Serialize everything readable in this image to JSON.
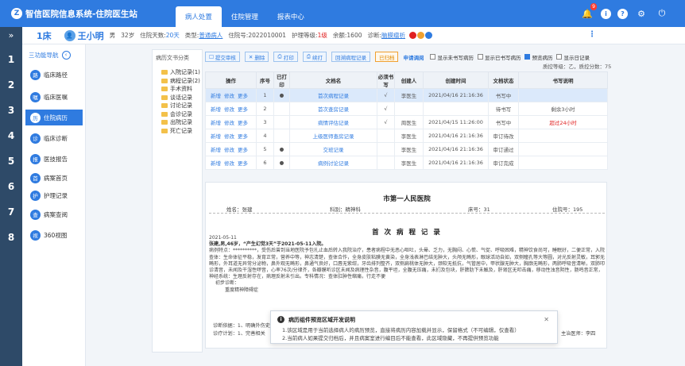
{
  "app": {
    "logo_text": "Z",
    "title": "智信医院信息系统-住院医生站"
  },
  "nav": [
    "病人处置",
    "住院管理",
    "报表中心"
  ],
  "top_icons": {
    "notification_count": "9"
  },
  "patient": {
    "bed": "1床",
    "name": "王小明",
    "gender": "男",
    "age": "32岁",
    "days_label": "住院天数:",
    "days": "20天",
    "type_label": "类型:",
    "type": "普通病人",
    "no_label": "住院号:",
    "no": "2022010001",
    "care_label": "护理等级:",
    "care": "1级",
    "balance_label": "余额:",
    "balance": "1600",
    "diag_label": "诊断:",
    "diag": "脑膜瘤析",
    "tag_colors": [
      "#e02020",
      "#f0a030",
      "#2f7be0"
    ]
  },
  "rail": [
    "1",
    "2",
    "3",
    "4",
    "5",
    "6",
    "7",
    "8"
  ],
  "sidebar": {
    "header": "三功能导航",
    "items": [
      {
        "label": "临床路径",
        "icon": "路"
      },
      {
        "label": "临床医嘱",
        "icon": "嘱"
      },
      {
        "label": "住院病历",
        "icon": "历",
        "active": true
      },
      {
        "label": "临床诊断",
        "icon": "诊"
      },
      {
        "label": "医技报告",
        "icon": "报"
      },
      {
        "label": "病案首页",
        "icon": "首"
      },
      {
        "label": "护理记录",
        "icon": "护"
      },
      {
        "label": "病案查阅",
        "icon": "查"
      },
      {
        "label": "360视图",
        "icon": "视"
      }
    ]
  },
  "categories": {
    "title": "病历文书分类",
    "items": [
      "入院记录(1)",
      "病程记录(2)",
      "手术资料",
      "谈话记录",
      "讨论记录",
      "会诊记录",
      "出院记录",
      "死亡记录"
    ]
  },
  "toolbar": {
    "buttons": [
      "提交审核",
      "删除",
      "打印",
      "续打",
      "回溯病程记录"
    ],
    "orange": "已归档",
    "link": "申请调阅",
    "checks": [
      {
        "label": "显示未书写病历",
        "on": false
      },
      {
        "label": "显示已书写病历",
        "on": false
      },
      {
        "label": "预览病历",
        "on": true
      },
      {
        "label": "显示日记录",
        "on": false
      }
    ],
    "score": "质控等级：乙，质控分数：75"
  },
  "table": {
    "headers": [
      "操作",
      "序号",
      "已打印",
      "文档名",
      "必须书写",
      "创建人",
      "创建时间",
      "文档状态",
      "书写说明"
    ],
    "rows": [
      {
        "ops": [
          "新增",
          "修改",
          "更多"
        ],
        "no": "1",
        "printed": "●",
        "name": "首次病程记录",
        "must": "√",
        "creator": "李医生",
        "time": "2021/04/16 21:16:36",
        "status": "书写中",
        "note": "",
        "sel": true
      },
      {
        "ops": [
          "新增",
          "修改",
          "更多"
        ],
        "no": "2",
        "printed": "",
        "name": "首次查房记录",
        "must": "√",
        "creator": "",
        "time": "",
        "status": "待书写",
        "note": "剩余3小时",
        "sel": false
      },
      {
        "ops": [
          "新增",
          "修改",
          "更多"
        ],
        "no": "3",
        "printed": "",
        "name": "病情评估记录",
        "must": "√",
        "creator": "周医生",
        "time": "2021/04/15 11:26:00",
        "status": "书写中",
        "note": "超过24小时",
        "sel": false
      },
      {
        "ops": [
          "新增",
          "修改",
          "更多"
        ],
        "no": "4",
        "printed": "",
        "name": "上级医师查房记录",
        "must": "",
        "creator": "李医生",
        "time": "2021/04/16 21:16:36",
        "status": "审订待改",
        "note": "",
        "sel": false
      },
      {
        "ops": [
          "新增",
          "修改",
          "更多"
        ],
        "no": "5",
        "printed": "●",
        "name": "交班记录",
        "must": "",
        "creator": "李医生",
        "time": "2021/04/16 21:16:36",
        "status": "审订通过",
        "note": "",
        "sel": false
      },
      {
        "ops": [
          "新增",
          "修改",
          "更多"
        ],
        "no": "6",
        "printed": "●",
        "name": "病例讨论记录",
        "must": "",
        "creator": "李医生",
        "time": "2021/04/16 21:16:36",
        "status": "审订完成",
        "note": "",
        "sel": false
      }
    ]
  },
  "doc": {
    "hospital": "市第一人民医院",
    "name_field": "姓名：张建",
    "dept_field": "科别：精神科",
    "bed_field": "床号：31",
    "no_field": "住院号：195",
    "heading": "首 次 病 程 记 录",
    "date": "2021-05-11",
    "intro": "张建,男,46岁，“产生幻觉3天”于2021-05-11入院。",
    "para": "病例特点：**********，受伤后曾到当地医院予包扎止血后转入我院治疗，患者病程中无恶心呕吐，头晕、乏力，无胸闷、心慌、气促、呼吸困难，精神饮食尚可，睡眠好，二便正常，入院查体：生命体征平稳，发育正常，营养中等，神志清楚，查体合作，全身皮肤粘膜无黄染，全身浅表淋巴结无肿大，头颅无畸形，眼球活动自如，双侧瞳孔等大等圆，对光反射灵敏，耳郭无畸形，外耳道无异常分泌物，鼻外观无畸形，鼻通气良好，口唇无紫绀，牙齿排列整齐，双侧扁桃体无肿大，颈软无抵抗，气管居中，甲状腺无肿大，胸廓无畸形，两肺呼吸音清晰，双肺叩诊清音，未闻及干湿性啰音，心率76次/分律齐，各瓣膜听诊区未闻及病理性杂音，腹平坦，全腹无压痛，未扪及包块，肝脾肋下未触及，肝肾区无叩击痛，移动性浊音阴性，肠鸣音正常，神经系统：生理反射存在，病理反射未引出。专科情况：查体肛肿性缩痛，行走不便",
    "init_diag_label": "初步诊断：",
    "init_diag": "重度精神障碍症",
    "basis": "诊断依据：1、明确外伤史",
    "plan": "诊疗计划：1、完善相关",
    "signer": "主治医师：李四"
  },
  "popup": {
    "title": "病历组件预览区域开发说明",
    "line1": "1.该区域是用于当前选择病人的病历预览，直接将病历内容加载并显示，保留格式（不可编辑，仅查看）",
    "line2": "2.当前病人如果提交归档后，并且病案室进行编目后不能查看，此区域隐藏，不再提供预览功能"
  }
}
